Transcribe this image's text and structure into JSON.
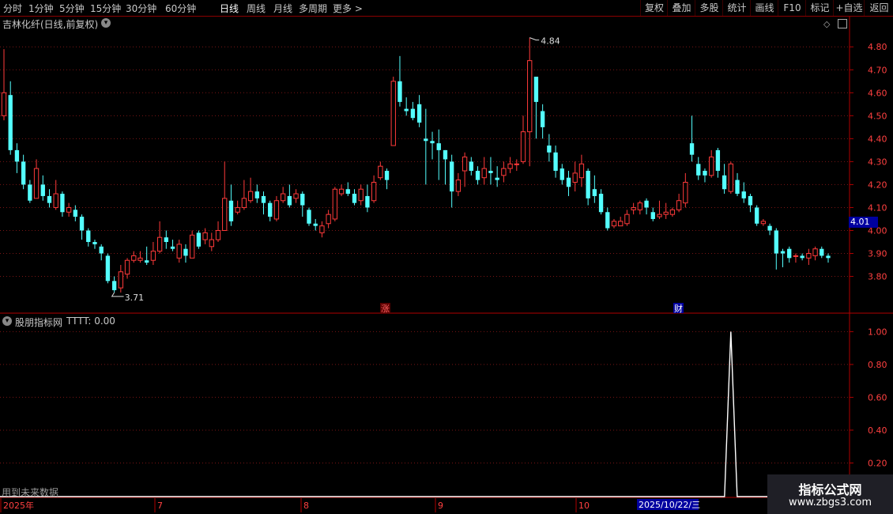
{
  "toolbar": {
    "periods": [
      {
        "label": "分时",
        "active": false
      },
      {
        "label": "1分钟",
        "active": false
      },
      {
        "label": "5分钟",
        "active": false
      },
      {
        "label": "15分钟",
        "active": false
      },
      {
        "label": "30分钟",
        "active": false
      },
      {
        "label": "60分钟",
        "active": false
      },
      {
        "label": "日线",
        "active": true
      },
      {
        "label": "周线",
        "active": false
      },
      {
        "label": "月线",
        "active": false
      },
      {
        "label": "多周期",
        "active": false
      },
      {
        "label": "更多 >",
        "active": false
      }
    ],
    "right_buttons": [
      "复权",
      "叠加",
      "多股",
      "统计",
      "画线",
      "F10",
      "标记",
      "+自选",
      "返回"
    ]
  },
  "stock_title": "吉林化纤(日线,前复权)",
  "indicator": {
    "name": "股朋指标网",
    "value_text": "TTTT: 0.00"
  },
  "future_note": "用到未来数据",
  "price_badge": "4.01",
  "markers": {
    "high_label": "4.84",
    "low_label": "3.71",
    "event_zhang": "涨",
    "event_cai": "财"
  },
  "date_axis": {
    "labels": [
      "2025年",
      "7",
      "8",
      "9",
      "10"
    ],
    "cursor_label": "2025/10/22/三"
  },
  "logo": {
    "title": "指标公式网",
    "url": "www.zbgs3.com"
  },
  "colors": {
    "up": "#ff3a3a",
    "down": "#54ffff",
    "grid": "#7a1515",
    "axis": "#b00000"
  },
  "chart_data": [
    {
      "type": "candlestick",
      "title": "吉林化纤(日线,前复权)",
      "y_ticks": [
        "3.80",
        "3.90",
        "4.00",
        "4.10",
        "4.20",
        "4.30",
        "4.40",
        "4.50",
        "4.60",
        "4.70",
        "4.80"
      ],
      "ylim": [
        3.64,
        4.88
      ],
      "candles": [
        [
          4.5,
          4.6,
          4.79,
          4.48
        ],
        [
          4.59,
          4.35,
          4.65,
          4.33
        ],
        [
          4.35,
          4.3,
          4.38,
          4.25
        ],
        [
          4.3,
          4.2,
          4.33,
          4.18
        ],
        [
          4.2,
          4.13,
          4.22,
          4.12
        ],
        [
          4.14,
          4.27,
          4.31,
          4.14
        ],
        [
          4.2,
          4.15,
          4.24,
          4.13
        ],
        [
          4.15,
          4.12,
          4.18,
          4.1
        ],
        [
          4.1,
          4.16,
          4.22,
          4.09
        ],
        [
          4.16,
          4.08,
          4.17,
          4.06
        ],
        [
          4.08,
          4.1,
          4.12,
          4.06
        ],
        [
          4.09,
          4.06,
          4.11,
          4.04
        ],
        [
          4.06,
          4.0,
          4.07,
          3.96
        ],
        [
          4.0,
          3.95,
          4.01,
          3.93
        ],
        [
          3.95,
          3.94,
          3.96,
          3.92
        ],
        [
          3.93,
          3.9,
          3.94,
          3.87
        ],
        [
          3.89,
          3.78,
          3.9,
          3.77
        ],
        [
          3.78,
          3.74,
          3.8,
          3.73
        ],
        [
          3.75,
          3.82,
          3.85,
          3.73
        ],
        [
          3.81,
          3.87,
          3.88,
          3.79
        ],
        [
          3.87,
          3.89,
          3.91,
          3.86
        ],
        [
          3.87,
          3.88,
          3.91,
          3.86
        ],
        [
          3.87,
          3.86,
          3.93,
          3.85
        ],
        [
          3.87,
          3.91,
          3.95,
          3.85
        ],
        [
          3.91,
          3.97,
          4.04,
          3.9
        ],
        [
          3.97,
          3.95,
          4.0,
          3.92
        ],
        [
          3.93,
          3.92,
          3.96,
          3.91
        ],
        [
          3.88,
          3.94,
          3.96,
          3.86
        ],
        [
          3.92,
          3.89,
          3.94,
          3.86
        ],
        [
          3.88,
          3.98,
          4.0,
          3.88
        ],
        [
          3.99,
          3.93,
          4.0,
          3.92
        ],
        [
          3.96,
          3.99,
          4.01,
          3.94
        ],
        [
          3.93,
          3.96,
          3.99,
          3.91
        ],
        [
          3.96,
          4.0,
          4.04,
          3.95
        ],
        [
          4.0,
          4.14,
          4.3,
          4.0
        ],
        [
          4.13,
          4.04,
          4.2,
          4.02
        ],
        [
          4.08,
          4.1,
          4.13,
          4.07
        ],
        [
          4.1,
          4.14,
          4.22,
          4.09
        ],
        [
          4.13,
          4.17,
          4.23,
          4.12
        ],
        [
          4.17,
          4.14,
          4.2,
          4.12
        ],
        [
          4.15,
          4.12,
          4.17,
          4.07
        ],
        [
          4.12,
          4.06,
          4.13,
          4.04
        ],
        [
          4.05,
          4.13,
          4.15,
          4.04
        ],
        [
          4.13,
          4.16,
          4.19,
          4.12
        ],
        [
          4.15,
          4.11,
          4.2,
          4.1
        ],
        [
          4.14,
          4.16,
          4.18,
          4.12
        ],
        [
          4.16,
          4.11,
          4.17,
          4.06
        ],
        [
          4.09,
          4.03,
          4.1,
          4.02
        ],
        [
          4.03,
          4.02,
          4.05,
          4.0
        ],
        [
          3.99,
          4.02,
          4.04,
          3.97
        ],
        [
          4.03,
          4.07,
          4.09,
          4.01
        ],
        [
          4.05,
          4.18,
          4.19,
          4.04
        ],
        [
          4.16,
          4.18,
          4.2,
          4.15
        ],
        [
          4.18,
          4.16,
          4.21,
          4.15
        ],
        [
          4.16,
          4.12,
          4.18,
          4.11
        ],
        [
          4.13,
          4.18,
          4.2,
          4.11
        ],
        [
          4.15,
          4.1,
          4.2,
          4.08
        ],
        [
          4.13,
          4.21,
          4.24,
          4.12
        ],
        [
          4.23,
          4.28,
          4.3,
          4.22
        ],
        [
          4.26,
          4.22,
          4.27,
          4.18
        ],
        [
          4.37,
          4.65,
          4.67,
          4.37
        ],
        [
          4.65,
          4.56,
          4.76,
          4.54
        ],
        [
          4.53,
          4.52,
          4.58,
          4.5
        ],
        [
          4.53,
          4.49,
          4.56,
          4.48
        ],
        [
          4.55,
          4.47,
          4.59,
          4.45
        ],
        [
          4.4,
          4.39,
          4.53,
          4.2
        ],
        [
          4.39,
          4.38,
          4.43,
          4.31
        ],
        [
          4.38,
          4.35,
          4.44,
          4.22
        ],
        [
          4.35,
          4.31,
          4.35,
          4.2
        ],
        [
          4.3,
          4.17,
          4.33,
          4.1
        ],
        [
          4.17,
          4.22,
          4.25,
          4.15
        ],
        [
          4.26,
          4.32,
          4.34,
          4.19
        ],
        [
          4.3,
          4.26,
          4.32,
          4.24
        ],
        [
          4.26,
          4.22,
          4.28,
          4.2
        ],
        [
          4.23,
          4.27,
          4.32,
          4.2
        ],
        [
          4.26,
          4.25,
          4.32,
          4.2
        ],
        [
          4.23,
          4.22,
          4.28,
          4.19
        ],
        [
          4.24,
          4.27,
          4.3,
          4.21
        ],
        [
          4.27,
          4.29,
          4.32,
          4.25
        ],
        [
          4.29,
          4.29,
          4.31,
          4.26
        ],
        [
          4.3,
          4.43,
          4.5,
          4.29
        ],
        [
          4.43,
          4.74,
          4.84,
          4.28
        ],
        [
          4.67,
          4.56,
          4.66,
          4.4
        ],
        [
          4.52,
          4.45,
          4.55,
          4.4
        ],
        [
          4.37,
          4.34,
          4.42,
          4.3
        ],
        [
          4.34,
          4.26,
          4.37,
          4.23
        ],
        [
          4.27,
          4.22,
          4.29,
          4.2
        ],
        [
          4.23,
          4.19,
          4.26,
          4.15
        ],
        [
          4.21,
          4.25,
          4.3,
          4.17
        ],
        [
          4.23,
          4.29,
          4.33,
          4.19
        ],
        [
          4.26,
          4.14,
          4.27,
          4.11
        ],
        [
          4.18,
          4.15,
          4.24,
          4.12
        ],
        [
          4.16,
          4.08,
          4.18,
          4.07
        ],
        [
          4.08,
          4.01,
          4.1,
          4.0
        ],
        [
          4.02,
          4.04,
          4.05,
          4.01
        ],
        [
          4.02,
          4.04,
          4.06,
          4.02
        ],
        [
          4.03,
          4.07,
          4.09,
          4.02
        ],
        [
          4.09,
          4.1,
          4.12,
          4.07
        ],
        [
          4.09,
          4.12,
          4.13,
          4.07
        ],
        [
          4.13,
          4.1,
          4.14,
          4.07
        ],
        [
          4.08,
          4.05,
          4.1,
          4.04
        ],
        [
          4.06,
          4.07,
          4.13,
          4.05
        ],
        [
          4.07,
          4.08,
          4.12,
          4.05
        ],
        [
          4.07,
          4.09,
          4.1,
          4.06
        ],
        [
          4.09,
          4.13,
          4.16,
          4.08
        ],
        [
          4.12,
          4.21,
          4.25,
          4.1
        ],
        [
          4.38,
          4.33,
          4.5,
          4.3
        ],
        [
          4.29,
          4.24,
          4.32,
          4.22
        ],
        [
          4.26,
          4.24,
          4.27,
          4.21
        ],
        [
          4.24,
          4.32,
          4.35,
          4.23
        ],
        [
          4.35,
          4.26,
          4.36,
          4.23
        ],
        [
          4.24,
          4.18,
          4.29,
          4.16
        ],
        [
          4.17,
          4.29,
          4.3,
          4.16
        ],
        [
          4.22,
          4.16,
          4.25,
          4.15
        ],
        [
          4.17,
          4.14,
          4.21,
          4.12
        ],
        [
          4.15,
          4.11,
          4.16,
          4.08
        ],
        [
          4.1,
          4.03,
          4.11,
          4.02
        ],
        [
          4.03,
          4.04,
          4.05,
          4.02
        ],
        [
          4.02,
          4.0,
          4.03,
          3.98
        ],
        [
          4.0,
          3.9,
          4.01,
          3.83
        ],
        [
          3.91,
          3.9,
          3.92,
          3.84
        ],
        [
          3.92,
          3.88,
          3.93,
          3.86
        ],
        [
          3.89,
          3.89,
          3.9,
          3.86
        ],
        [
          3.89,
          3.88,
          3.9,
          3.87
        ],
        [
          3.88,
          3.9,
          3.92,
          3.85
        ],
        [
          3.89,
          3.92,
          3.93,
          3.87
        ],
        [
          3.92,
          3.89,
          3.93,
          3.88
        ],
        [
          3.89,
          3.88,
          3.9,
          3.86
        ]
      ]
    },
    {
      "type": "line",
      "series": [
        {
          "name": "TTTT",
          "x_index_of_spike": 112,
          "spike_value": 1.0,
          "baseline": 0.0
        }
      ],
      "y_ticks": [
        "0.20",
        "0.40",
        "0.60",
        "0.80",
        "1.00"
      ],
      "ylim": [
        0,
        1.05
      ]
    }
  ]
}
